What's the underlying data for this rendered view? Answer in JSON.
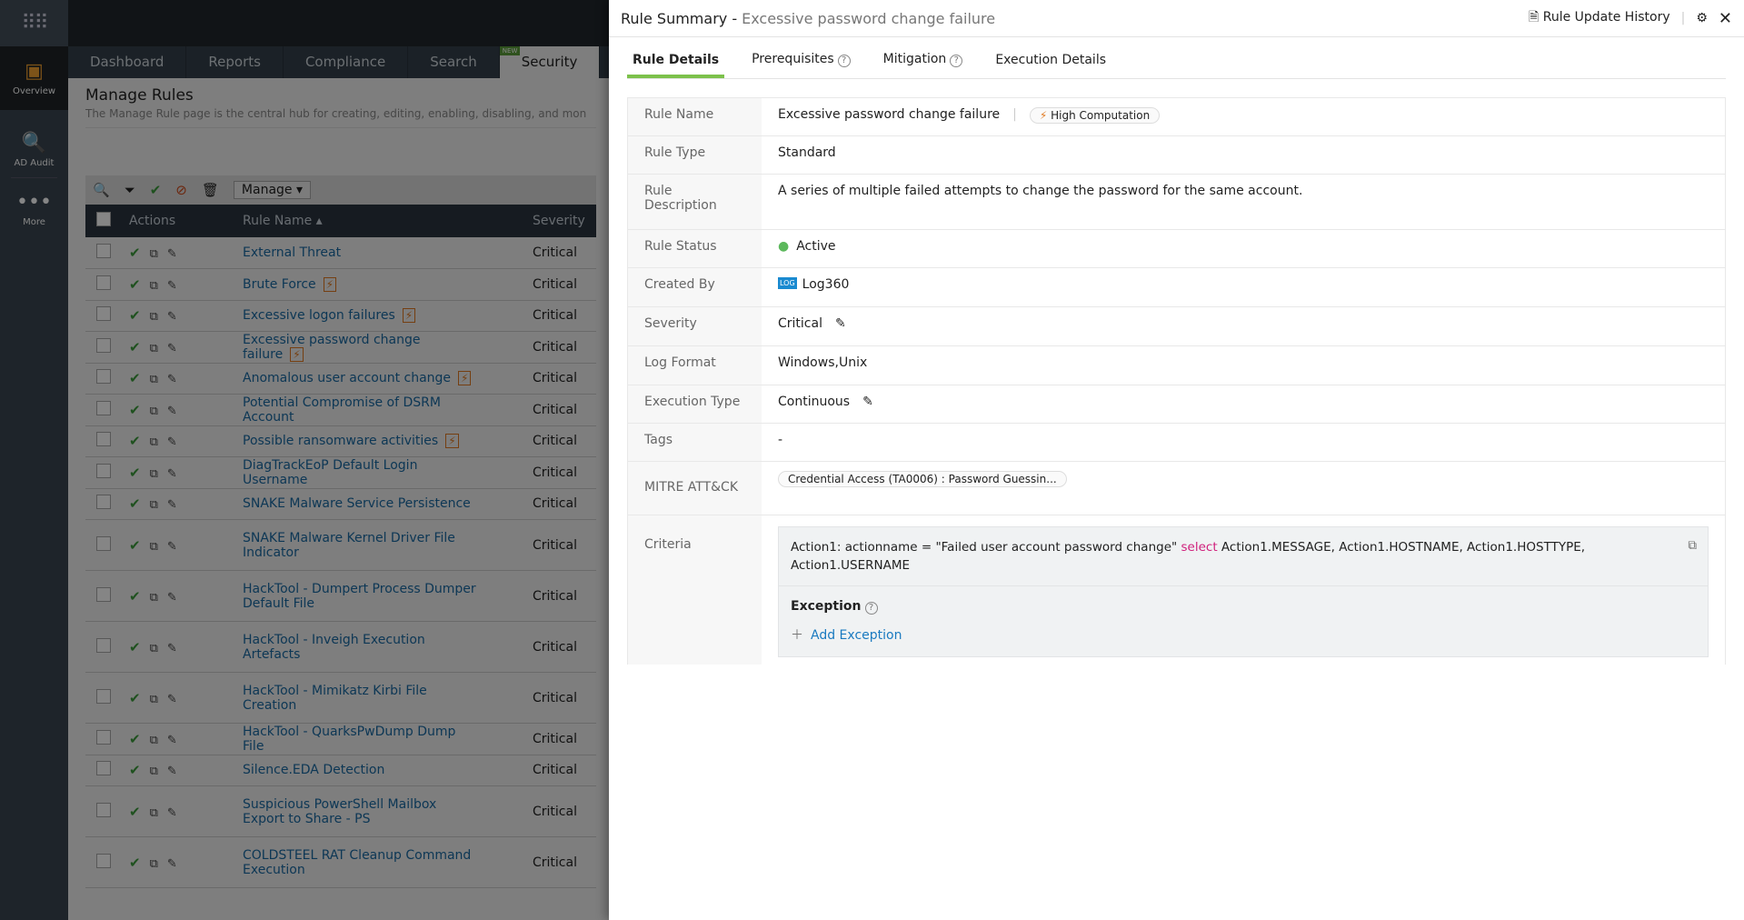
{
  "sidebar": {
    "apps_icon": "grid-icon",
    "items": [
      {
        "label": "Overview",
        "icon": "dashboard-icon"
      },
      {
        "label": "AD Audit",
        "icon": "ad-audit-icon"
      },
      {
        "label": "More",
        "icon": "more-icon"
      }
    ]
  },
  "nav": {
    "tabs": [
      {
        "label": "Dashboard"
      },
      {
        "label": "Reports"
      },
      {
        "label": "Compliance"
      },
      {
        "label": "Search"
      },
      {
        "label": "Security",
        "badge": "NEW"
      }
    ]
  },
  "page": {
    "title": "Manage Rules",
    "description": "The Manage Rule page is the central hub for creating, editing, enabling, disabling, and mon",
    "manage_label": "Manage"
  },
  "table": {
    "columns": [
      "Actions",
      "Rule Name",
      "Severity"
    ],
    "rows": [
      {
        "name": "External Threat",
        "severity": "Critical",
        "hc": false
      },
      {
        "name": "Brute Force",
        "severity": "Critical",
        "hc": true
      },
      {
        "name": "Excessive logon failures",
        "severity": "Critical",
        "hc": true
      },
      {
        "name": "Excessive password change failure",
        "severity": "Critical",
        "hc": true
      },
      {
        "name": "Anomalous user account change",
        "severity": "Critical",
        "hc": true
      },
      {
        "name": "Potential Compromise of DSRM Account",
        "severity": "Critical",
        "hc": false
      },
      {
        "name": "Possible ransomware activities",
        "severity": "Critical",
        "hc": true
      },
      {
        "name": "DiagTrackEoP Default Login Username",
        "severity": "Critical",
        "hc": false
      },
      {
        "name": "SNAKE Malware Service Persistence",
        "severity": "Critical",
        "hc": false
      },
      {
        "name": "SNAKE Malware Kernel Driver File Indicator",
        "severity": "Critical",
        "hc": false
      },
      {
        "name": "HackTool - Dumpert Process Dumper Default File",
        "severity": "Critical",
        "hc": false
      },
      {
        "name": "HackTool - Inveigh Execution Artefacts",
        "severity": "Critical",
        "hc": false
      },
      {
        "name": "HackTool - Mimikatz Kirbi File Creation",
        "severity": "Critical",
        "hc": false
      },
      {
        "name": "HackTool - QuarksPwDump Dump File",
        "severity": "Critical",
        "hc": false
      },
      {
        "name": "Silence.EDA Detection",
        "severity": "Critical",
        "hc": false
      },
      {
        "name": "Suspicious PowerShell Mailbox Export to Share - PS",
        "severity": "Critical",
        "hc": false
      },
      {
        "name": "COLDSTEEL RAT Cleanup Command Execution",
        "severity": "Critical",
        "hc": false
      }
    ]
  },
  "panel": {
    "title": "Rule Summary -",
    "subtitle": "Excessive password change failure",
    "history_label": "Rule Update History",
    "tabs": [
      {
        "label": "Rule Details",
        "active": true
      },
      {
        "label": "Prerequisites",
        "help": true
      },
      {
        "label": "Mitigation",
        "help": true
      },
      {
        "label": "Execution Details"
      }
    ],
    "details": {
      "rule_name_label": "Rule Name",
      "rule_name": "Excessive password change failure",
      "hc_label": "High Computation",
      "rule_type_label": "Rule Type",
      "rule_type": "Standard",
      "desc_label": "Rule Description",
      "desc": "A series of multiple failed attempts to change the password for the same account.",
      "status_label": "Rule Status",
      "status": "Active",
      "status_color": "#5cb85c",
      "created_label": "Created By",
      "created": "Log360",
      "severity_label": "Severity",
      "severity": "Critical",
      "log_format_label": "Log Format",
      "log_format": "Windows,Unix",
      "exec_label": "Execution Type",
      "exec": "Continuous",
      "tags_label": "Tags",
      "tags": "-",
      "mitre_label": "MITRE ATT&CK",
      "mitre": "Credential Access (TA0006) : Password Guessin...",
      "criteria_label": "Criteria",
      "criteria_pre": "Action1: actionname = \"Failed user account password change\" ",
      "criteria_kw": "select",
      "criteria_post": " Action1.MESSAGE, Action1.HOSTNAME, Action1.HOSTTYPE, Action1.USERNAME",
      "exception_label": "Exception",
      "add_exception": "Add Exception"
    }
  }
}
